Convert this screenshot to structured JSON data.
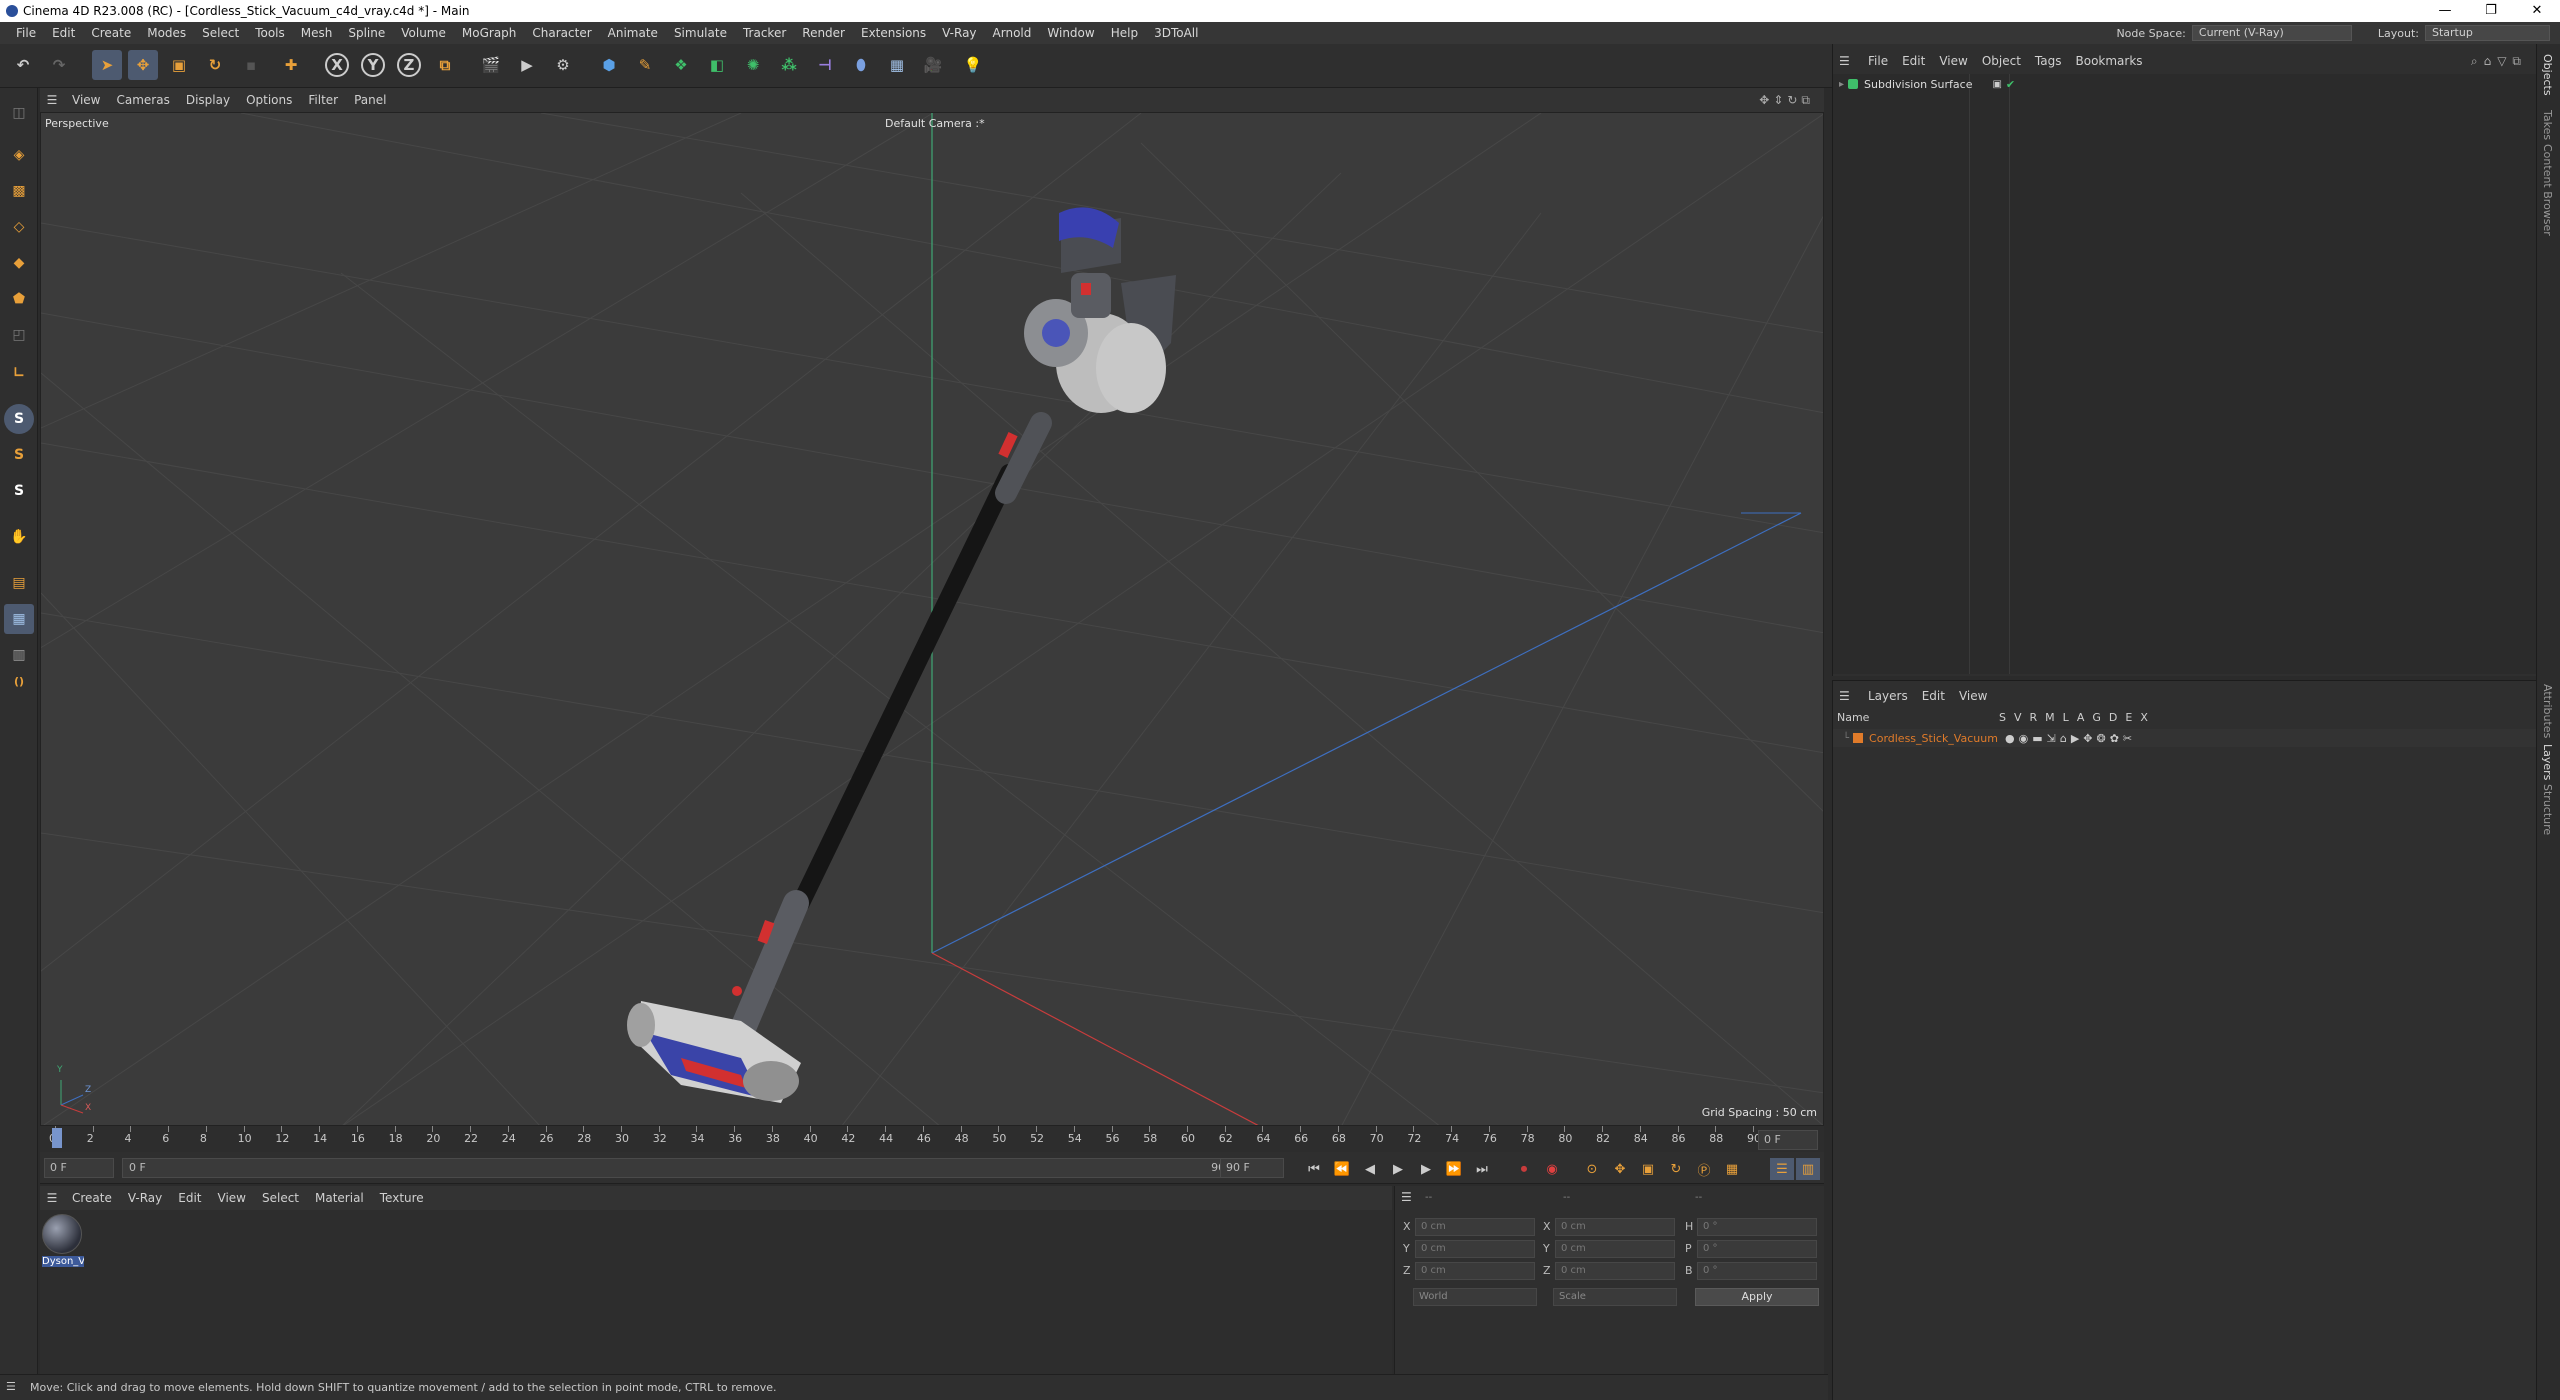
{
  "window": {
    "title": "Cinema 4D R23.008 (RC) - [Cordless_Stick_Vacuum_c4d_vray.c4d *] - Main",
    "minimize": "—",
    "restore": "❐",
    "close": "✕"
  },
  "menubar": {
    "items": [
      "File",
      "Edit",
      "Create",
      "Modes",
      "Select",
      "Tools",
      "Mesh",
      "Spline",
      "Volume",
      "MoGraph",
      "Character",
      "Animate",
      "Simulate",
      "Tracker",
      "Render",
      "Extensions",
      "V-Ray",
      "Arnold",
      "Window",
      "Help",
      "3DToAll"
    ],
    "node_space_label": "Node Space:",
    "node_space_value": "Current (V-Ray)",
    "layout_label": "Layout:",
    "layout_value": "Startup"
  },
  "toolbar": {
    "axis_x": "X",
    "axis_y": "Y",
    "axis_z": "Z"
  },
  "viewport": {
    "menu": [
      "View",
      "Cameras",
      "Display",
      "Options",
      "Filter",
      "Panel"
    ],
    "view_name": "Perspective",
    "camera": "Default Camera",
    "camera_mark": ":*",
    "grid_spacing": "Grid Spacing : 50 cm",
    "axis_y": "Y",
    "axis_z": "Z",
    "axis_x": "X"
  },
  "timeline": {
    "ticks": [
      "0",
      "2",
      "4",
      "6",
      "8",
      "10",
      "12",
      "14",
      "16",
      "18",
      "20",
      "22",
      "24",
      "26",
      "28",
      "30",
      "32",
      "34",
      "36",
      "38",
      "40",
      "42",
      "44",
      "46",
      "48",
      "50",
      "52",
      "54",
      "56",
      "58",
      "60",
      "62",
      "64",
      "66",
      "68",
      "70",
      "72",
      "74",
      "76",
      "78",
      "80",
      "82",
      "84",
      "86",
      "88",
      "90"
    ],
    "current_frame": "0 F",
    "start_field": "0 F",
    "range_start": "0 F",
    "range_end": "90 F",
    "end_field": "90 F"
  },
  "material_manager": {
    "menu": [
      "Create",
      "V-Ray",
      "Edit",
      "View",
      "Select",
      "Material",
      "Texture"
    ],
    "material_name": "Dyson_V"
  },
  "coordinates": {
    "x_pos": "0 cm",
    "y_pos": "0 cm",
    "z_pos": "0 cm",
    "x_size": "0 cm",
    "y_size": "0 cm",
    "z_size": "0 cm",
    "h_rot": "0 °",
    "p_rot": "0 °",
    "b_rot": "0 °",
    "label_x": "X",
    "label_y": "Y",
    "label_z": "Z",
    "label_h": "H",
    "label_p": "P",
    "label_b": "B",
    "dash1": "--",
    "dash2": "--",
    "dash3": "--",
    "mode_world": "World",
    "mode_scale": "Scale",
    "apply": "Apply"
  },
  "objects_panel": {
    "menu": [
      "File",
      "Edit",
      "View",
      "Object",
      "Tags",
      "Bookmarks"
    ],
    "object_name": "Subdivision Surface"
  },
  "layers_panel": {
    "menu": [
      "Layers",
      "Edit",
      "View"
    ],
    "col_name": "Name",
    "col_flags": [
      "S",
      "V",
      "R",
      "M",
      "L",
      "A",
      "G",
      "D",
      "E",
      "X"
    ],
    "layer_name": "Cordless_Stick_Vacuum"
  },
  "side_tabs": [
    "Objects",
    "Takes",
    "Content Browser",
    "Attributes",
    "Layers",
    "Structure"
  ],
  "statusbar": {
    "text": "Move: Click and drag to move elements. Hold down SHIFT to quantize movement / add to the selection in point mode, CTRL to remove."
  },
  "colors": {
    "layer_orange": "#e07b2a",
    "accent_blue": "#4a78c8",
    "green_axis": "#3fa874",
    "red_axis": "#c83c3c"
  }
}
